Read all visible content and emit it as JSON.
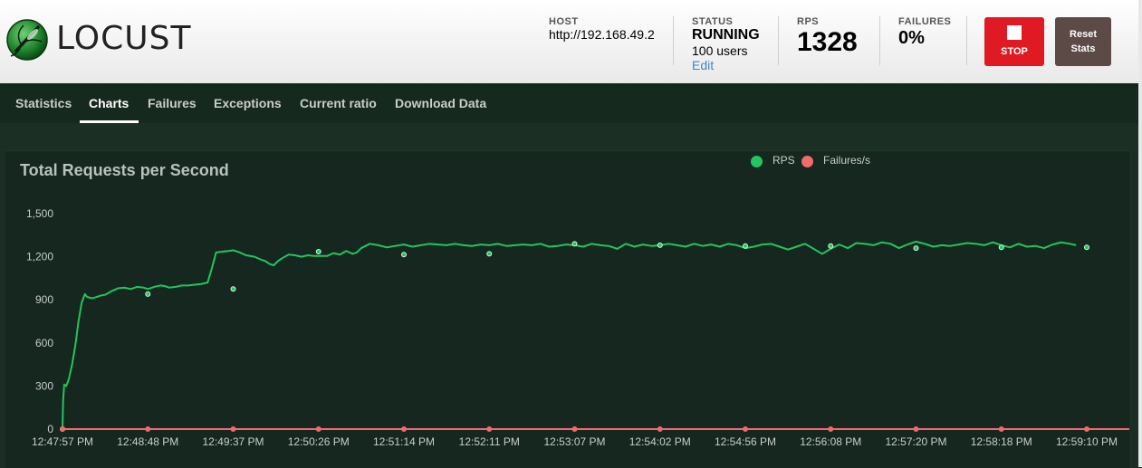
{
  "app": {
    "logo_text": "LOCUST"
  },
  "header": {
    "host_label": "HOST",
    "host_value": "http://192.168.49.2",
    "status_label": "STATUS",
    "status_value": "RUNNING",
    "users_value": "100 users",
    "edit_label": "Edit",
    "rps_label": "RPS",
    "rps_value": "1328",
    "failures_label": "FAILURES",
    "failures_value": "0%",
    "stop_label": "STOP",
    "reset_label_1": "Reset",
    "reset_label_2": "Stats"
  },
  "nav": {
    "tabs": [
      {
        "label": "Statistics"
      },
      {
        "label": "Charts"
      },
      {
        "label": "Failures"
      },
      {
        "label": "Exceptions"
      },
      {
        "label": "Current ratio"
      },
      {
        "label": "Download Data"
      }
    ],
    "active_tab": "Charts"
  },
  "colors": {
    "rps": "#22c55e",
    "failures": "#f06b6b",
    "accent_stop": "#e01a23"
  },
  "chart_data": {
    "type": "line",
    "title": "Total Requests per Second",
    "legend": [
      "RPS",
      "Failures/s"
    ],
    "legend_position": "top-center",
    "ylim": [
      0,
      1500
    ],
    "yticks": [
      "1,500",
      "1,200",
      "900",
      "600",
      "300",
      "0"
    ],
    "ytick_values": [
      1500,
      1200,
      900,
      600,
      300,
      0
    ],
    "x_tick_labels": [
      "12:47:57 PM",
      "12:48:48 PM",
      "12:49:37 PM",
      "12:50:26 PM",
      "12:51:14 PM",
      "12:52:11 PM",
      "12:53:07 PM",
      "12:54:02 PM",
      "12:54:56 PM",
      "12:56:08 PM",
      "12:57:20 PM",
      "12:58:18 PM",
      "12:59:10 PM"
    ],
    "series": [
      {
        "name": "RPS",
        "color": "#22c55e",
        "points": [
          [
            0,
            0
          ],
          [
            0.03,
            200
          ],
          [
            0.08,
            310
          ],
          [
            0.18,
            300
          ],
          [
            0.3,
            350
          ],
          [
            0.45,
            450
          ],
          [
            0.6,
            580
          ],
          [
            0.75,
            750
          ],
          [
            0.9,
            880
          ],
          [
            1.05,
            940
          ],
          [
            1.15,
            920
          ],
          [
            1.4,
            910
          ],
          [
            1.6,
            920
          ],
          [
            1.8,
            930
          ],
          [
            2.0,
            935
          ],
          [
            2.3,
            960
          ],
          [
            2.6,
            980
          ],
          [
            2.9,
            985
          ],
          [
            3.2,
            975
          ],
          [
            3.5,
            990
          ],
          [
            3.8,
            985
          ],
          [
            4.0,
            975
          ],
          [
            4.3,
            990
          ],
          [
            4.6,
            1000
          ],
          [
            4.8,
            995
          ],
          [
            5.0,
            985
          ],
          [
            5.3,
            990
          ],
          [
            5.6,
            1000
          ],
          [
            5.9,
            1000
          ],
          [
            6.2,
            1005
          ],
          [
            6.5,
            1010
          ],
          [
            6.8,
            1020
          ],
          [
            7.0,
            1120
          ],
          [
            7.2,
            1230
          ],
          [
            7.5,
            1235
          ],
          [
            7.8,
            1240
          ],
          [
            8.0,
            1245
          ],
          [
            8.3,
            1230
          ],
          [
            8.6,
            1210
          ],
          [
            9.0,
            1200
          ],
          [
            9.3,
            1180
          ],
          [
            9.5,
            1170
          ],
          [
            9.7,
            1150
          ],
          [
            9.9,
            1140
          ],
          [
            10.1,
            1170
          ],
          [
            10.3,
            1190
          ],
          [
            10.6,
            1215
          ],
          [
            10.9,
            1210
          ],
          [
            11.2,
            1200
          ],
          [
            11.5,
            1210
          ],
          [
            11.8,
            1205
          ],
          [
            12.1,
            1205
          ],
          [
            12.4,
            1205
          ],
          [
            12.7,
            1225
          ],
          [
            13.0,
            1215
          ],
          [
            13.3,
            1240
          ],
          [
            13.6,
            1220
          ],
          [
            13.8,
            1230
          ],
          [
            14.0,
            1260
          ],
          [
            14.4,
            1290
          ],
          [
            14.8,
            1280
          ],
          [
            15.2,
            1265
          ],
          [
            15.6,
            1275
          ],
          [
            16.0,
            1285
          ],
          [
            16.4,
            1270
          ],
          [
            16.8,
            1280
          ],
          [
            17.2,
            1290
          ],
          [
            17.6,
            1285
          ],
          [
            18.0,
            1280
          ],
          [
            18.4,
            1290
          ],
          [
            18.8,
            1280
          ],
          [
            19.2,
            1275
          ],
          [
            19.6,
            1285
          ],
          [
            20.0,
            1280
          ],
          [
            20.4,
            1290
          ],
          [
            20.8,
            1275
          ],
          [
            21.2,
            1280
          ],
          [
            21.6,
            1285
          ],
          [
            22.0,
            1280
          ],
          [
            22.4,
            1290
          ],
          [
            22.8,
            1270
          ],
          [
            23.2,
            1275
          ],
          [
            23.6,
            1285
          ],
          [
            24.0,
            1280
          ],
          [
            24.4,
            1270
          ],
          [
            24.8,
            1290
          ],
          [
            25.2,
            1280
          ],
          [
            25.6,
            1275
          ],
          [
            26.0,
            1255
          ],
          [
            26.4,
            1290
          ],
          [
            26.8,
            1270
          ],
          [
            27.2,
            1285
          ],
          [
            27.6,
            1275
          ],
          [
            28.0,
            1280
          ],
          [
            28.4,
            1290
          ],
          [
            28.8,
            1280
          ],
          [
            29.2,
            1270
          ],
          [
            29.6,
            1290
          ],
          [
            30.0,
            1275
          ],
          [
            30.4,
            1285
          ],
          [
            30.8,
            1270
          ],
          [
            31.2,
            1290
          ],
          [
            31.6,
            1280
          ],
          [
            32.0,
            1260
          ],
          [
            32.4,
            1270
          ],
          [
            32.8,
            1285
          ],
          [
            33.2,
            1290
          ],
          [
            33.6,
            1270
          ],
          [
            34.0,
            1250
          ],
          [
            34.4,
            1270
          ],
          [
            34.8,
            1290
          ],
          [
            35.2,
            1255
          ],
          [
            35.6,
            1220
          ],
          [
            36.0,
            1255
          ],
          [
            36.4,
            1285
          ],
          [
            36.8,
            1260
          ],
          [
            37.2,
            1295
          ],
          [
            37.6,
            1290
          ],
          [
            38.0,
            1280
          ],
          [
            38.4,
            1300
          ],
          [
            38.8,
            1290
          ],
          [
            39.2,
            1260
          ],
          [
            39.6,
            1285
          ],
          [
            40.0,
            1305
          ],
          [
            40.4,
            1290
          ],
          [
            40.8,
            1270
          ],
          [
            41.2,
            1280
          ],
          [
            41.6,
            1275
          ],
          [
            42.0,
            1285
          ],
          [
            42.4,
            1295
          ],
          [
            42.8,
            1290
          ],
          [
            43.2,
            1280
          ],
          [
            43.6,
            1300
          ],
          [
            44.0,
            1280
          ],
          [
            44.4,
            1265
          ],
          [
            44.8,
            1290
          ],
          [
            45.2,
            1270
          ],
          [
            45.6,
            1275
          ],
          [
            46.0,
            1260
          ],
          [
            46.4,
            1285
          ],
          [
            46.8,
            1300
          ],
          [
            47.2,
            1290
          ],
          [
            47.5,
            1280
          ]
        ],
        "markers_at_ticks": [
          0,
          940,
          975,
          1235,
          1215,
          1220,
          1290,
          1280,
          1275,
          1275,
          1260,
          1265,
          1265
        ]
      },
      {
        "name": "Failures/s",
        "color": "#f06b6b",
        "values_at_ticks": [
          0,
          0,
          0,
          0,
          0,
          0,
          0,
          0,
          0,
          0,
          0,
          0,
          0
        ]
      }
    ]
  }
}
